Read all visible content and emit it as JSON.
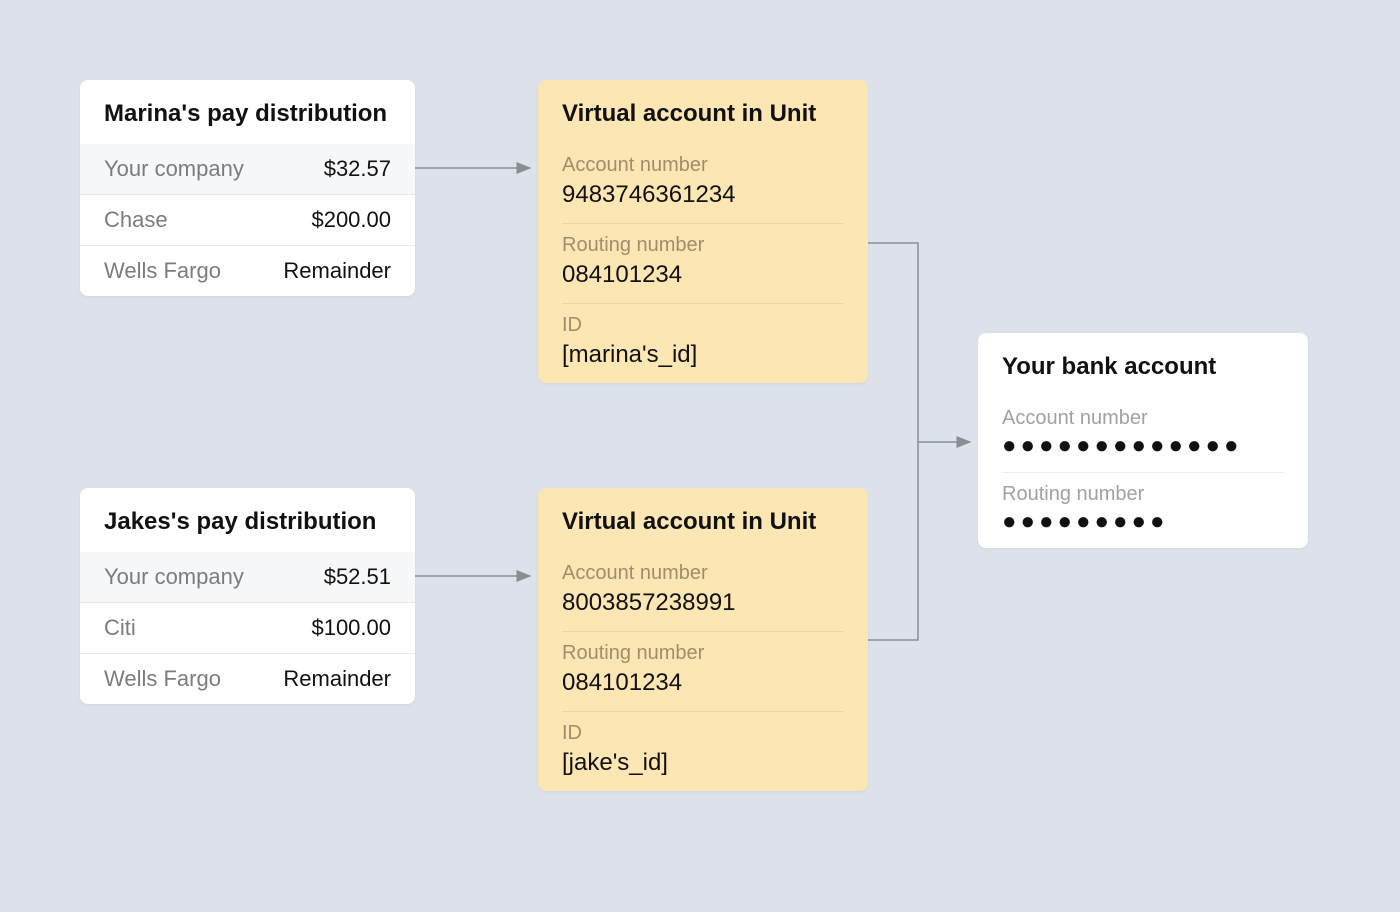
{
  "pay_distributions": {
    "marina": {
      "title": "Marina's pay distribution",
      "rows": [
        {
          "label": "Your company",
          "value": "$32.57"
        },
        {
          "label": "Chase",
          "value": "$200.00"
        },
        {
          "label": "Wells Fargo",
          "value": "Remainder"
        }
      ]
    },
    "jake": {
      "title": "Jakes's pay distribution",
      "rows": [
        {
          "label": "Your company",
          "value": "$52.51"
        },
        {
          "label": "Citi",
          "value": "$100.00"
        },
        {
          "label": "Wells Fargo",
          "value": "Remainder"
        }
      ]
    }
  },
  "virtual_accounts": {
    "marina": {
      "title": "Virtual account in Unit",
      "account_label": "Account number",
      "account_value": "9483746361234",
      "routing_label": "Routing number",
      "routing_value": "084101234",
      "id_label": "ID",
      "id_value": "[marina's_id]"
    },
    "jake": {
      "title": "Virtual account in Unit",
      "account_label": "Account number",
      "account_value": "8003857238991",
      "routing_label": "Routing number",
      "routing_value": "084101234",
      "id_label": "ID",
      "id_value": "[jake's_id]"
    }
  },
  "bank_account": {
    "title": "Your bank account",
    "account_label": "Account number",
    "account_value": "●●●●●●●●●●●●●",
    "routing_label": "Routing number",
    "routing_value": "●●●●●●●●●"
  }
}
